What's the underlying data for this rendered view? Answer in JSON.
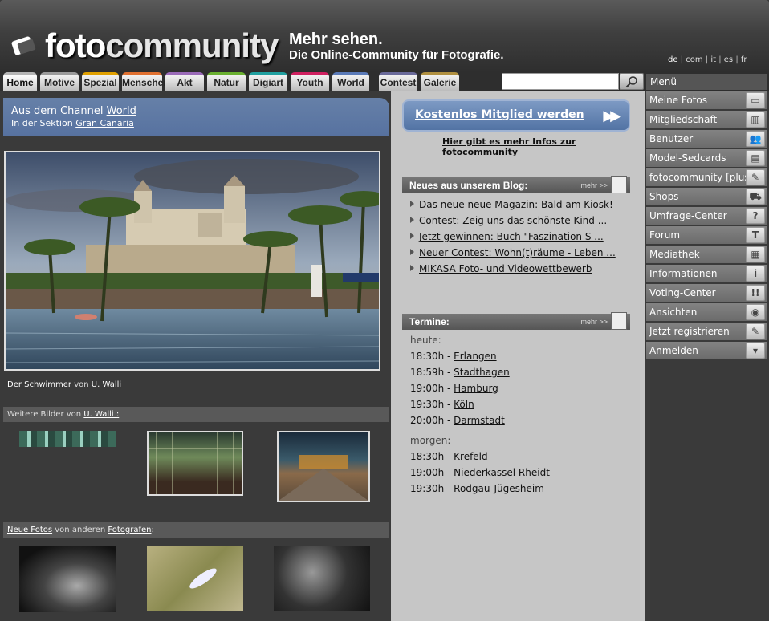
{
  "header": {
    "logo_text_a": "foto",
    "logo_text_b": "community",
    "tagline_1": "Mehr sehen.",
    "tagline_2": "Die Online-Community für Fotografie."
  },
  "languages": [
    "de",
    "com",
    "it",
    "es",
    "fr"
  ],
  "tabs": [
    {
      "label": "Home",
      "color": "#b5b5b5"
    },
    {
      "label": "Motive",
      "color": "#9b9b9b"
    },
    {
      "label": "Spezial",
      "color": "#e0a000"
    },
    {
      "label": "Menschen",
      "color": "#e07030"
    },
    {
      "label": "Akt",
      "color": "#9a6ab8"
    },
    {
      "label": "Natur",
      "color": "#6ab030"
    },
    {
      "label": "Digiart",
      "color": "#20a0a0"
    },
    {
      "label": "Youth",
      "color": "#d02060"
    },
    {
      "label": "World",
      "color": "#5a7ab8"
    },
    {
      "label": "Contest",
      "color": "#6a6a9a"
    },
    {
      "label": "Galerie",
      "color": "#b09040"
    }
  ],
  "search": {
    "placeholder": ""
  },
  "channel": {
    "prefix": "Aus dem Channel",
    "channel_name": "World",
    "section_prefix": "In der Sektion",
    "section_name": "Gran Canaria"
  },
  "main_photo": {
    "title": "Der Schwimmer",
    "by": "von",
    "author": "U. Walli"
  },
  "more_images": {
    "prefix": "Weitere Bilder von",
    "author": "U. Walli :"
  },
  "new_photos": {
    "label": "Neue Fotos",
    "middle": "von anderen",
    "link": "Fotografen",
    "suffix": ":"
  },
  "join": {
    "label": "Kostenlos Mitglied werden",
    "arrows": "▶▶"
  },
  "info_link": "Hier gibt es mehr Infos zur fotocommunity",
  "blog": {
    "title": "Neues aus unserem Blog:",
    "more": "mehr >>",
    "items": [
      "Das neue neue Magazin: Bald am Kiosk!",
      "Contest: Zeig uns das schönste Kind ...",
      "Jetzt gewinnen: Buch \"Faszination S ...",
      "Neuer Contest: Wohn(t)räume - Leben ...",
      "MIKASA Foto- und Videowettbewerb"
    ]
  },
  "events": {
    "title": "Termine:",
    "more": "mehr >>",
    "today_label": "heute:",
    "today": [
      {
        "time": "18:30h",
        "city": "Erlangen"
      },
      {
        "time": "18:59h",
        "city": "Stadthagen"
      },
      {
        "time": "19:00h",
        "city": "Hamburg"
      },
      {
        "time": "19:30h",
        "city": "Köln"
      },
      {
        "time": "20:00h",
        "city": "Darmstadt"
      }
    ],
    "tomorrow_label": "morgen:",
    "tomorrow": [
      {
        "time": "18:30h",
        "city": "Krefeld"
      },
      {
        "time": "19:00h",
        "city": "Niederkassel Rheidt"
      },
      {
        "time": "19:30h",
        "city": "Rodgau-Jügesheim"
      }
    ]
  },
  "menu": {
    "title": "Menü",
    "items": [
      {
        "label": "Meine Fotos",
        "icon": "photos-icon",
        "glyph": "▭"
      },
      {
        "label": "Mitgliedschaft",
        "icon": "membership-icon",
        "glyph": "▥"
      },
      {
        "label": "Benutzer",
        "icon": "users-icon",
        "glyph": "👥"
      },
      {
        "label": "Model-Sedcards",
        "icon": "sedcard-icon",
        "glyph": "▤"
      },
      {
        "label": "fotocommunity [plus]",
        "icon": "plus-new-icon",
        "glyph": "✎"
      },
      {
        "label": "Shops",
        "icon": "cart-icon",
        "glyph": "⛟"
      },
      {
        "label": "Umfrage-Center",
        "icon": "question-icon",
        "glyph": "?"
      },
      {
        "label": "Forum",
        "icon": "forum-icon",
        "glyph": "T"
      },
      {
        "label": "Mediathek",
        "icon": "mediathek-icon",
        "glyph": "▦"
      },
      {
        "label": "Informationen",
        "icon": "info-icon",
        "glyph": "i"
      },
      {
        "label": "Voting-Center",
        "icon": "voting-icon",
        "glyph": "!!"
      },
      {
        "label": "Ansichten",
        "icon": "eye-icon",
        "glyph": "◉"
      },
      {
        "label": "Jetzt registrieren",
        "icon": "pen-icon",
        "glyph": "✎"
      },
      {
        "label": "Anmelden",
        "icon": "login-icon",
        "glyph": "▾"
      }
    ]
  }
}
